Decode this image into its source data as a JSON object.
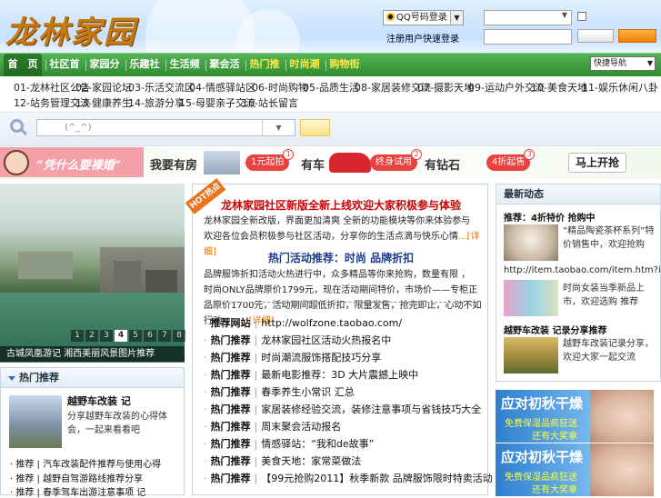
{
  "header": {
    "logo": "龙林家园",
    "qq_login_label": "QQ号码登录",
    "register_link": "注册用户快速登录",
    "select_value": "",
    "remember_checkbox": false
  },
  "nav": {
    "items": [
      {
        "label": "首　页"
      },
      {
        "label": "社区首页"
      },
      {
        "label": "家园分享"
      },
      {
        "label": "乐趣社区"
      },
      {
        "label": "生活频道"
      },
      {
        "label": "聚会活动"
      },
      {
        "label": "热门推荐"
      },
      {
        "label": "时尚潮流"
      },
      {
        "label": "购物街区"
      }
    ],
    "select_label": "快捷导航"
  },
  "categories": [
    "01-龙林社区公告",
    "02-家园论坛",
    "03-乐活交流区",
    "04-情感驿站区",
    "05-品质生活",
    "06-时尚购物",
    "07-摄影天地",
    "08-家居装修交流",
    "09-运动户外交流",
    "10-美食天地",
    "11-娱乐休闲八卦",
    "12-站务管理交流",
    "13-健康养生",
    "14-旅游分享",
    "15-母婴亲子交流",
    "16-站长留言"
  ],
  "search": {
    "placeholder": "(^_^)",
    "button_label": ""
  },
  "banner": {
    "slogan": "“凭什么要裸婚”",
    "house": "我要有房",
    "house_badge": "1元起拍",
    "car": "有车",
    "car_badge": "终身试用",
    "diamond": "有钻石",
    "diamond_badge": "4折起售",
    "go": "马上开抢",
    "badge_nums": [
      "1",
      "2",
      "3"
    ]
  },
  "slideshow": {
    "pages": [
      "1",
      "2",
      "3",
      "4",
      "5",
      "6",
      "7",
      "8"
    ],
    "active_index": 3,
    "caption": "古城凤凰游记 湘西美丽风景图片推荐"
  },
  "sidebar_box": {
    "title": "热门推荐",
    "feature_title": "越野车改装 记",
    "feature_desc": "分享越野车改装的心得体会，一起来看看吧",
    "items": [
      {
        "tag": "推荐",
        "text": "汽车改装配件推荐与使用心得"
      },
      {
        "tag": "推荐",
        "text": "越野自驾游路线推荐分享"
      },
      {
        "tag": "推荐",
        "text": "春季驾车出游注意事项 记"
      }
    ]
  },
  "center": {
    "hot_label": "HOT热点",
    "headline1": "龙林家园社区新版全新上线欢迎大家积极参与体验",
    "para1": "龙林家园全新改版，界面更加清爽  全新的功能模块等你来体验参与 欢迎各位会员积极参与社区活动，分享你的生活点滴与快乐心情",
    "more1": "...[详细]",
    "headline2": "热门活动推荐：时尚 品牌折扣",
    "para2": "品牌服饰折扣活动火热进行中，众多精品等你来抢购，数量有限 ， 时尚ONLY品牌原价1799元，现在活动期间特价，市场价——专柜正品原价1700元，活动期间超低折扣，限量发售，抢完即止，心动不如行动 ，",
    "more2": "…..[详细]",
    "list": [
      {
        "tag": "推荐网站",
        "text": "http://wolfzone.taobao.com/"
      },
      {
        "tag": "热门推荐",
        "text": "龙林家园社区活动火热报名中"
      },
      {
        "tag": "热门推荐",
        "text": "时尚潮流服饰搭配技巧分享"
      },
      {
        "tag": "热门推荐",
        "text": "最新电影推荐：3D 大片震撼上映中"
      },
      {
        "tag": "热门推荐",
        "text": "春季养生小常识 汇总"
      },
      {
        "tag": "热门推荐",
        "text": "家居装修经验交流，装修注意事项与省钱技巧大全"
      },
      {
        "tag": "热门推荐",
        "text": "周末聚会活动报名"
      },
      {
        "tag": "热门推荐",
        "text": "情感驿站：“我和de故事”"
      },
      {
        "tag": "热门推荐",
        "text": "美食天地：家常菜做法"
      },
      {
        "tag": "热门推荐",
        "text": "【99元抢购2011】秋季新款 品牌服饰限时特卖活动"
      }
    ]
  },
  "right_box": {
    "title": "最新动态",
    "item1_title": "推荐：4折特价 抢购中",
    "item1_text": "“精品陶瓷茶杯系列”特价销售中，欢迎抢购",
    "url": "http://item.taobao.com/item.htm?id",
    "item2_text": "时尚女装当季新品上市，欢迎选购 推荐",
    "item3_title": "越野车改装 记录分享推荐",
    "item3_text": "越野车改装记录分享，欢迎大家一起交流"
  },
  "ads": [
    {
      "title": "应对初秋干燥",
      "line1": "免费保湿品疯狂送",
      "line2": "还有大奖拿"
    },
    {
      "title": "应对初秋干燥",
      "line1": "免费保湿品疯狂送",
      "line2": "还有大奖拿"
    }
  ],
  "colors": {
    "nav_green": "#3a9a3a",
    "highlight_yellow": "#ffe84a",
    "headline_red": "#cc0000",
    "headline_blue": "#1a3a8a",
    "more_orange": "#e07000"
  }
}
